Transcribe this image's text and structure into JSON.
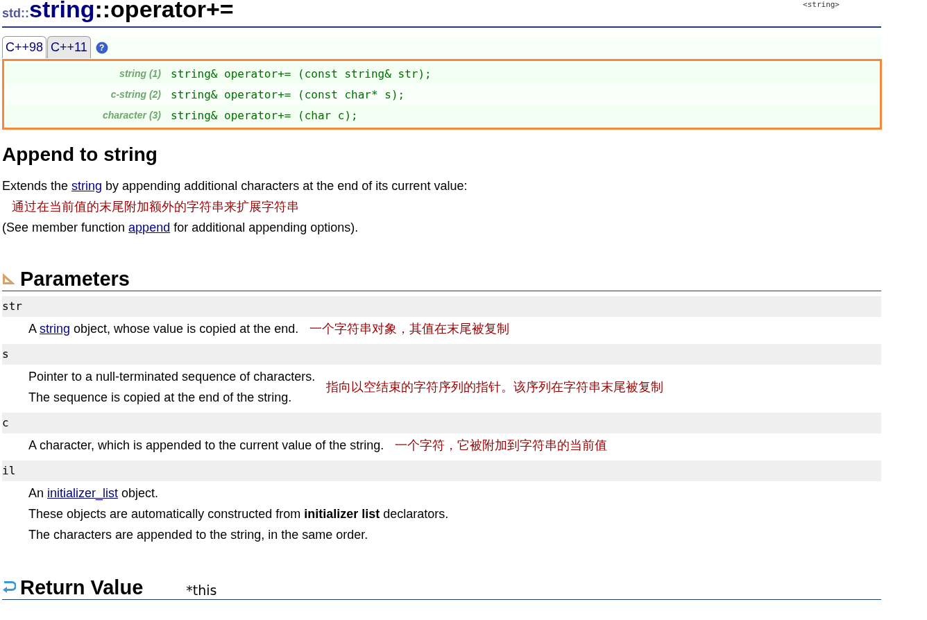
{
  "header": {
    "namespace": "std::",
    "class_name": "string",
    "member": "::operator+=",
    "corner_text": "<string>"
  },
  "tabs": [
    {
      "label": "C++98",
      "selected": true
    },
    {
      "label": "C++11",
      "selected": false
    }
  ],
  "help_icon": {
    "label": "?"
  },
  "signatures": [
    {
      "label": "string (1)",
      "code": "string& operator+= (const string& str);"
    },
    {
      "label": "c-string (2)",
      "code": "string& operator+= (const char* s);"
    },
    {
      "label": "character (3)",
      "code": "string& operator+= (char c);"
    }
  ],
  "summary": {
    "heading": "Append to string",
    "lines": [
      [
        {
          "kind": "text",
          "text": "Extends the "
        },
        {
          "kind": "link",
          "text": "string"
        },
        {
          "kind": "text",
          "text": " by appending additional characters at the end of its current value:"
        }
      ],
      [
        {
          "kind": "note",
          "text": "通过在当前值的末尾附加额外的字符串来扩展字符串"
        }
      ],
      [
        {
          "kind": "text",
          "text": "(See member function "
        },
        {
          "kind": "link",
          "text": "append"
        },
        {
          "kind": "text",
          "text": " for additional appending options)."
        }
      ]
    ]
  },
  "parameters": {
    "heading": "Parameters",
    "items": [
      {
        "name": "str",
        "lines": [
          [
            {
              "kind": "text",
              "text": "A "
            },
            {
              "kind": "link",
              "text": "string"
            },
            {
              "kind": "text",
              "text": " object, whose value is copied at the end."
            }
          ]
        ],
        "note": "一个字符串对象，其值在末尾被复制"
      },
      {
        "name": "s",
        "lines": [
          [
            {
              "kind": "text",
              "text": "Pointer to a null-terminated sequence of characters."
            }
          ],
          [
            {
              "kind": "text",
              "text": "The sequence is copied at the end of the string."
            }
          ]
        ],
        "note": "指向以空结束的字符序列的指针。该序列在字符串末尾被复制"
      },
      {
        "name": "c",
        "lines": [
          [
            {
              "kind": "text",
              "text": "A character, which is appended to the current value of the string."
            }
          ]
        ],
        "note": "一个字符，它被附加到字符串的当前值"
      },
      {
        "name": "il",
        "lines": [
          [
            {
              "kind": "text",
              "text": "An "
            },
            {
              "kind": "link",
              "text": "initializer_list"
            },
            {
              "kind": "text",
              "text": " object."
            }
          ],
          [
            {
              "kind": "text",
              "text": "These objects are automatically constructed from **initializer list** declarators."
            }
          ],
          [
            {
              "kind": "text",
              "text": "The characters are appended to the string, in the same order."
            }
          ]
        ]
      }
    ]
  },
  "return_value": {
    "heading": "Return Value",
    "value": "*this"
  }
}
